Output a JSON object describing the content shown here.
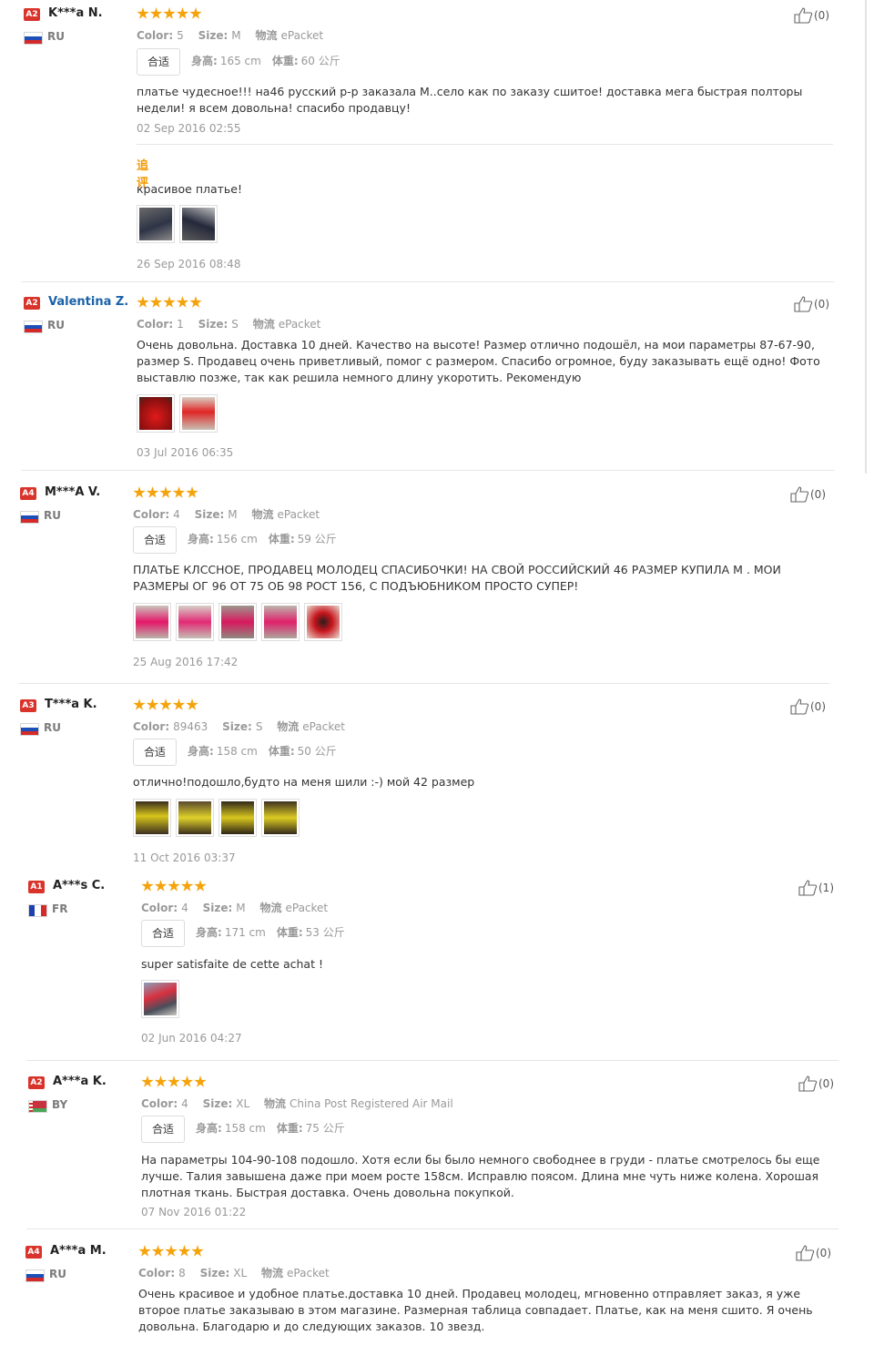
{
  "reviews": [
    {
      "level": "A2",
      "name": "K***a N.",
      "country": "RU",
      "color_label": "Color:",
      "color": "5",
      "size_label": "Size:",
      "size": "M",
      "ship_label": "物流",
      "ship": "ePacket",
      "fit": "合适",
      "height_label": "身高:",
      "height": "165 cm",
      "weight_label": "体重:",
      "weight": "60 公斤",
      "text": "платье чудесное!!! на46 русский р-р заказала М..село как по заказу сшитое! доставка мега быстрая полторы недели! я всем довольна! спасибо продавцу!",
      "date": "02 Sep 2016 02:55",
      "followup_label": "追评",
      "followup_text": "красивое платье!",
      "followup_date": "26 Sep 2016 08:48",
      "like": "(0)"
    },
    {
      "level": "A2",
      "name": "Valentina Z.",
      "country": "RU",
      "color_label": "Color:",
      "color": "1",
      "size_label": "Size:",
      "size": "S",
      "ship_label": "物流",
      "ship": "ePacket",
      "text": "Очень довольна. Доставка 10 дней. Качество на высоте! Размер отлично подошёл, на мои параметры 87-67-90, размер S. Продавец очень приветливый, помог с размером. Спасибо огромное, буду заказывать ещё одно! Фото выставлю позже, так как решила немного длину укоротить. Рекомендую",
      "date": "03 Jul 2016 06:35",
      "like": "(0)"
    },
    {
      "level": "A4",
      "name": "M***A V.",
      "country": "RU",
      "color_label": "Color:",
      "color": "4",
      "size_label": "Size:",
      "size": "M",
      "ship_label": "物流",
      "ship": "ePacket",
      "fit": "合适",
      "height_label": "身高:",
      "height": "156 cm",
      "weight_label": "体重:",
      "weight": "59 公斤",
      "text": "ПЛАТЬЕ КЛССНОЕ, ПРОДАВЕЦ МОЛОДЕЦ СПАСИБОЧКИ! НА СВОЙ РОССИЙСКИЙ 46 РАЗМЕР КУПИЛА М . МОИ РАЗМЕРЫ ОГ 96 ОТ 75 ОБ 98 РОСТ 156, С ПОДЪЮБНИКОМ ПРОСТО СУПЕР!",
      "date": "25 Aug 2016 17:42",
      "like": "(0)"
    },
    {
      "level": "A3",
      "name": "T***a K.",
      "country": "RU",
      "color_label": "Color:",
      "color": "89463",
      "size_label": "Size:",
      "size": "S",
      "ship_label": "物流",
      "ship": "ePacket",
      "fit": "合适",
      "height_label": "身高:",
      "height": "158 cm",
      "weight_label": "体重:",
      "weight": "50 公斤",
      "text": "отлично!подошло,будто на меня шили :-) мой 42 размер",
      "date": "11 Oct 2016 03:37",
      "like": "(0)"
    },
    {
      "level": "A1",
      "name": "A***s C.",
      "country": "FR",
      "color_label": "Color:",
      "color": "4",
      "size_label": "Size:",
      "size": "M",
      "ship_label": "物流",
      "ship": "ePacket",
      "fit": "合适",
      "height_label": "身高:",
      "height": "171 cm",
      "weight_label": "体重:",
      "weight": "53 公斤",
      "text": "super satisfaite de cette achat !",
      "date": "02 Jun 2016 04:27",
      "like": "(1)"
    },
    {
      "level": "A2",
      "name": "A***a K.",
      "country": "BY",
      "color_label": "Color:",
      "color": "4",
      "size_label": "Size:",
      "size": "XL",
      "ship_label": "物流",
      "ship": "China Post Registered Air Mail",
      "fit": "合适",
      "height_label": "身高:",
      "height": "158 cm",
      "weight_label": "体重:",
      "weight": "75 公斤",
      "text": "На параметры 104-90-108 подошло. Хотя если бы было немного свободнее в груди - платье смотрелось бы еще лучше. Талия завышена даже при моем росте 158см. Исправлю поясом. Длина мне чуть ниже колена. Хорошая плотная ткань. Быстрая доставка. Очень довольна покупкой.",
      "date": "07 Nov 2016 01:22",
      "like": "(0)"
    },
    {
      "level": "A4",
      "name": "A***a M.",
      "country": "RU",
      "color_label": "Color:",
      "color": "8",
      "size_label": "Size:",
      "size": "XL",
      "ship_label": "物流",
      "ship": "ePacket",
      "text": "Очень красивое и удобное платье.доставка 10 дней. Продавец молодец, мгновенно отправляет заказ, я уже второе платье заказываю в этом магазине. Размерная таблица совпадает. Платье, как на меня сшито. Я очень довольна. Благодарю и до следующих заказов. 10 звезд.",
      "like": "(0)"
    }
  ],
  "colors": {
    "star": "#f5a30b",
    "level_badge": "#d9342b",
    "followup": "#f39800",
    "link_name": "#1a62a8"
  }
}
